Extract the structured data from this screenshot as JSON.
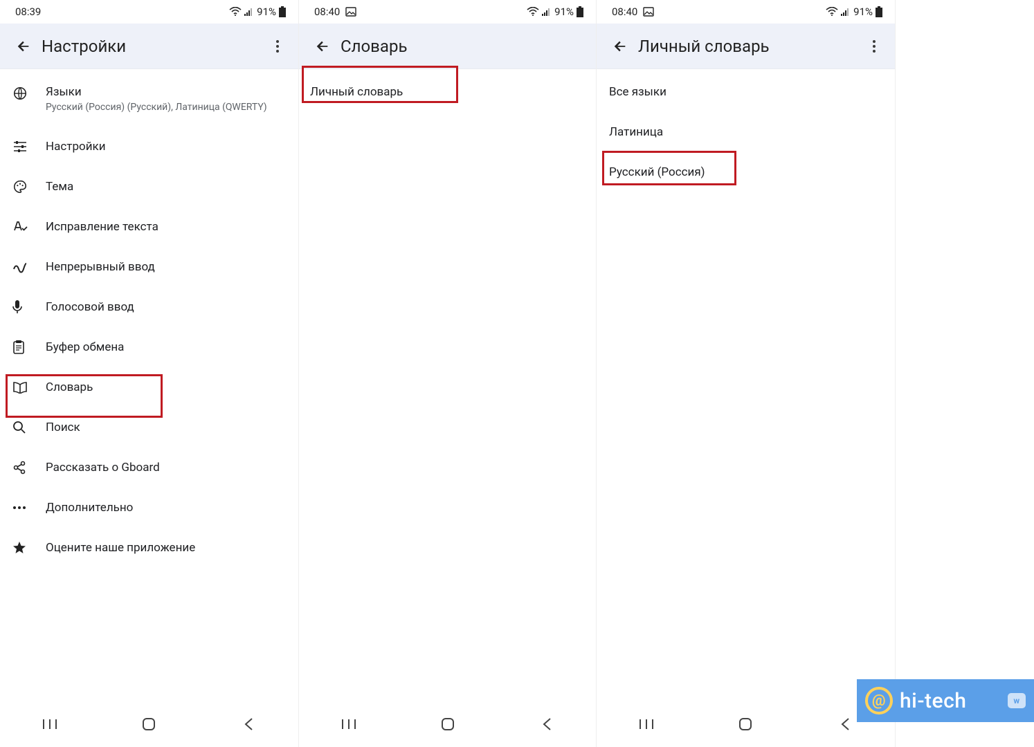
{
  "status": {
    "battery": "91%",
    "times": [
      "08:39",
      "08:40",
      "08:40"
    ]
  },
  "panel1": {
    "title": "Настройки",
    "items": [
      {
        "label": "Языки",
        "sub": "Русский (Россия) (Русский), Латиница (QWERTY)"
      },
      {
        "label": "Настройки"
      },
      {
        "label": "Тема"
      },
      {
        "label": "Исправление текста"
      },
      {
        "label": "Непрерывный ввод"
      },
      {
        "label": "Голосовой ввод"
      },
      {
        "label": "Буфер обмена"
      },
      {
        "label": "Словарь"
      },
      {
        "label": "Поиск"
      },
      {
        "label": "Рассказать о Gboard"
      },
      {
        "label": "Дополнительно"
      },
      {
        "label": "Оцените наше приложение"
      }
    ]
  },
  "panel2": {
    "title": "Словарь",
    "items": [
      {
        "label": "Личный словарь"
      }
    ]
  },
  "panel3": {
    "title": "Личный словарь",
    "items": [
      {
        "label": "Все языки"
      },
      {
        "label": "Латиница"
      },
      {
        "label": "Русский (Россия)"
      }
    ]
  },
  "watermark": "hi-tech"
}
